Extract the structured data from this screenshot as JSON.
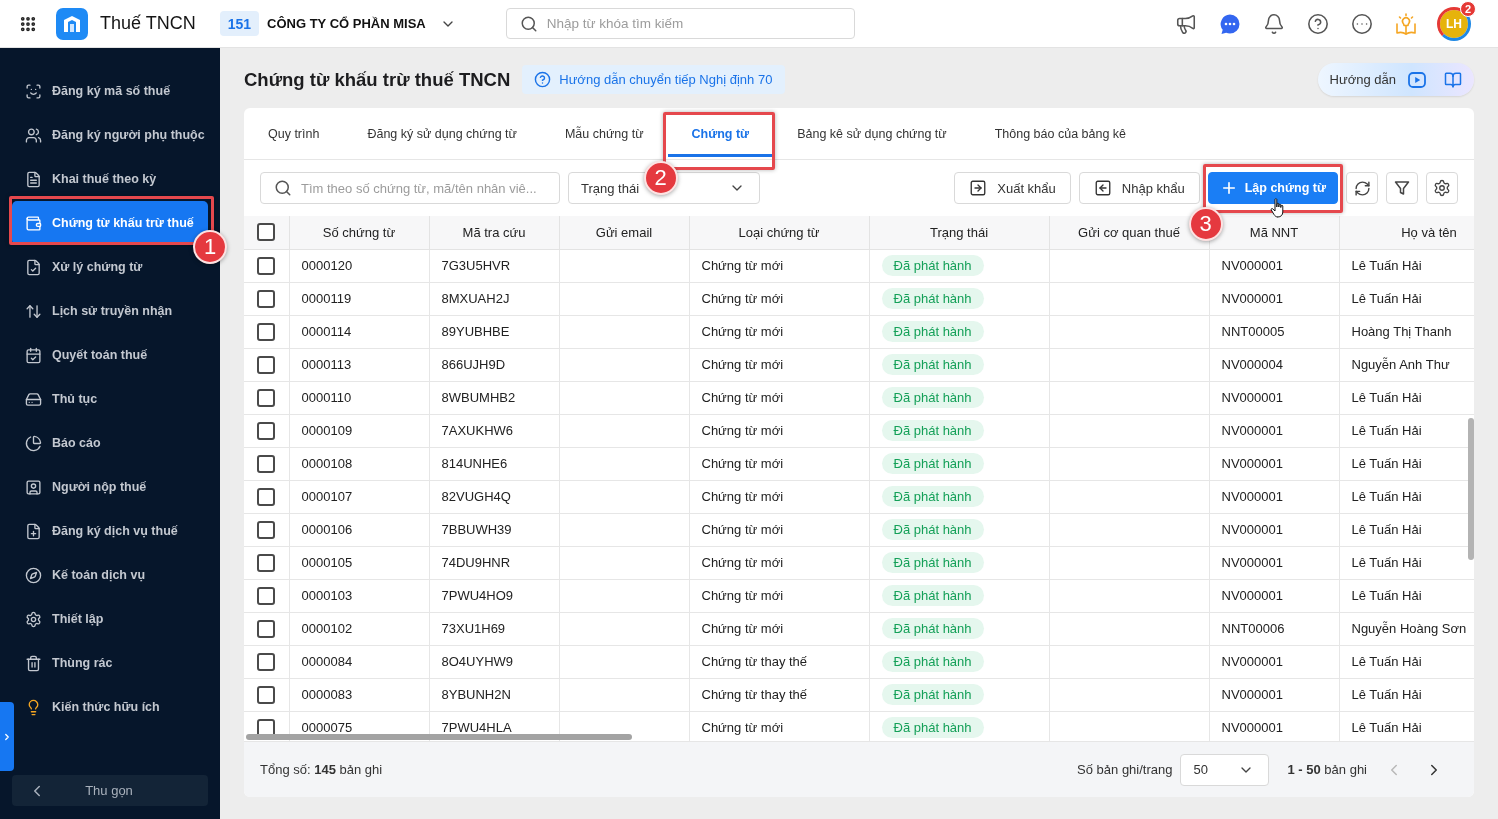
{
  "topbar": {
    "app_name": "Thuế TNCN",
    "company_code": "151",
    "company_name": "CÔNG TY CỔ PHẦN MISA",
    "search": {
      "placeholder": "Nhập từ khóa tìm kiếm"
    },
    "avatar": {
      "initials": "LH",
      "badge": "2"
    }
  },
  "sidebar": {
    "items": [
      {
        "label": "Đăng ký mã số thuế",
        "selected": false
      },
      {
        "label": "Đăng ký người phụ thuộc",
        "selected": false
      },
      {
        "label": "Khai thuế theo kỳ",
        "selected": false
      },
      {
        "label": "Chứng từ khấu trừ thuế",
        "selected": true
      },
      {
        "label": "Xử lý chứng từ",
        "selected": false
      },
      {
        "label": "Lịch sử truyền nhận",
        "selected": false
      },
      {
        "label": "Quyết toán thuế",
        "selected": false
      },
      {
        "label": "Thủ tục",
        "selected": false
      },
      {
        "label": "Báo cáo",
        "selected": false
      },
      {
        "label": "Người nộp thuế",
        "selected": false
      },
      {
        "label": "Đăng ký dịch vụ thuế",
        "selected": false
      },
      {
        "label": "Kế toán dịch vụ",
        "selected": false
      },
      {
        "label": "Thiết lập",
        "selected": false
      },
      {
        "label": "Thùng rác",
        "selected": false
      },
      {
        "label": "Kiến thức hữu ích",
        "selected": false
      }
    ],
    "collapse_label": "Thu gọn"
  },
  "page": {
    "title": "Chứng từ khấu trừ thuế TNCN",
    "guide_link": "Hướng dẫn chuyển tiếp Nghị định 70",
    "help_label": "Hướng dẫn"
  },
  "tabs": [
    {
      "label": "Quy trình",
      "selected": false
    },
    {
      "label": "Đăng ký sử dụng chứng từ",
      "selected": false
    },
    {
      "label": "Mẫu chứng từ",
      "selected": false
    },
    {
      "label": "Chứng từ",
      "selected": true
    },
    {
      "label": "Bảng kê sử dụng chứng từ",
      "selected": false
    },
    {
      "label": "Thông báo của bảng kê",
      "selected": false
    }
  ],
  "toolbar": {
    "search": {
      "placeholder": "Tìm theo số chứng từ, mã/tên nhân viê..."
    },
    "status_filter": {
      "label": "Trạng thái"
    },
    "buttons": [
      {
        "label": "Xuất khẩu",
        "kind": "export"
      },
      {
        "label": "Nhập khẩu",
        "kind": "import"
      },
      {
        "label": "Lập chứng từ",
        "kind": "create"
      }
    ]
  },
  "table": {
    "all_checked": false,
    "columns": [
      "Số chứng từ",
      "Mã tra cứu",
      "Gửi email",
      "Loại chứng từ",
      "Trạng thái",
      "Gửi cơ quan thuế",
      "Mã NNT",
      "Họ và tên"
    ],
    "rows": [
      {
        "checked": false,
        "number": "0000120",
        "lookup_code": "7G3U5HVR",
        "type": "Chứng từ mới",
        "status": "Đã phát hành",
        "taxpayer_code": "NV000001",
        "full_name": "Lê Tuấn Hải"
      },
      {
        "checked": false,
        "number": "0000119",
        "lookup_code": "8MXUAH2J",
        "type": "Chứng từ mới",
        "status": "Đã phát hành",
        "taxpayer_code": "NV000001",
        "full_name": "Lê Tuấn Hải"
      },
      {
        "checked": false,
        "number": "0000114",
        "lookup_code": "89YUBHBE",
        "type": "Chứng từ mới",
        "status": "Đã phát hành",
        "taxpayer_code": "NNT00005",
        "full_name": "Hoàng Thị Thanh"
      },
      {
        "checked": false,
        "number": "0000113",
        "lookup_code": "866UJH9D",
        "type": "Chứng từ mới",
        "status": "Đã phát hành",
        "taxpayer_code": "NV000004",
        "full_name": "Nguyễn Anh Thư"
      },
      {
        "checked": false,
        "number": "0000110",
        "lookup_code": "8WBUMHB2",
        "type": "Chứng từ mới",
        "status": "Đã phát hành",
        "taxpayer_code": "NV000001",
        "full_name": "Lê Tuấn Hải"
      },
      {
        "checked": false,
        "number": "0000109",
        "lookup_code": "7AXUKHW6",
        "type": "Chứng từ mới",
        "status": "Đã phát hành",
        "taxpayer_code": "NV000001",
        "full_name": "Lê Tuấn Hải"
      },
      {
        "checked": false,
        "number": "0000108",
        "lookup_code": "814UNHE6",
        "type": "Chứng từ mới",
        "status": "Đã phát hành",
        "taxpayer_code": "NV000001",
        "full_name": "Lê Tuấn Hải"
      },
      {
        "checked": false,
        "number": "0000107",
        "lookup_code": "82VUGH4Q",
        "type": "Chứng từ mới",
        "status": "Đã phát hành",
        "taxpayer_code": "NV000001",
        "full_name": "Lê Tuấn Hải"
      },
      {
        "checked": false,
        "number": "0000106",
        "lookup_code": "7BBUWH39",
        "type": "Chứng từ mới",
        "status": "Đã phát hành",
        "taxpayer_code": "NV000001",
        "full_name": "Lê Tuấn Hải"
      },
      {
        "checked": false,
        "number": "0000105",
        "lookup_code": "74DU9HNR",
        "type": "Chứng từ mới",
        "status": "Đã phát hành",
        "taxpayer_code": "NV000001",
        "full_name": "Lê Tuấn Hải"
      },
      {
        "checked": false,
        "number": "0000103",
        "lookup_code": "7PWU4HO9",
        "type": "Chứng từ mới",
        "status": "Đã phát hành",
        "taxpayer_code": "NV000001",
        "full_name": "Lê Tuấn Hải"
      },
      {
        "checked": false,
        "number": "0000102",
        "lookup_code": "73XU1H69",
        "type": "Chứng từ mới",
        "status": "Đã phát hành",
        "taxpayer_code": "NNT00006",
        "full_name": "Nguyễn Hoàng Sơn"
      },
      {
        "checked": false,
        "number": "0000084",
        "lookup_code": "8O4UYHW9",
        "type": "Chứng từ thay thế",
        "status": "Đã phát hành",
        "taxpayer_code": "NV000001",
        "full_name": "Lê Tuấn Hải"
      },
      {
        "checked": false,
        "number": "0000083",
        "lookup_code": "8YBUNH2N",
        "type": "Chứng từ thay thế",
        "status": "Đã phát hành",
        "taxpayer_code": "NV000001",
        "full_name": "Lê Tuấn Hải"
      },
      {
        "checked": false,
        "number": "0000075",
        "lookup_code": "7PWU4HLA",
        "type": "Chứng từ mới",
        "status": "Đã phát hành",
        "taxpayer_code": "NV000001",
        "full_name": "Lê Tuấn Hải"
      }
    ]
  },
  "footer": {
    "total": "Tổng số: **145** bản ghi",
    "page_size_label": "Số bản ghi/trang",
    "page_size": "50",
    "range": "**1 - 50** bản ghi",
    "pager": [
      {
        "kind": "previous",
        "disabled": true
      },
      {
        "kind": "next",
        "disabled": false
      }
    ]
  },
  "annotations": [
    {
      "number": "1"
    },
    {
      "number": "2"
    },
    {
      "number": "3"
    }
  ]
}
